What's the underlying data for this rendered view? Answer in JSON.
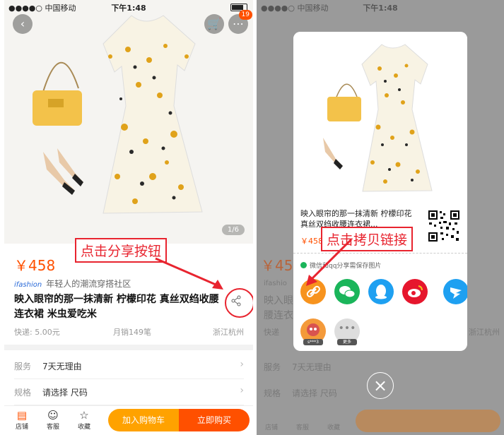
{
  "status": {
    "carrier": "●●●●○ 中国移动",
    "time": "下午1:48"
  },
  "left": {
    "cart_badge": "19",
    "pager": "1/6",
    "price": "￥458",
    "shop_logo": "ifashion",
    "shop_name": "年轻人的潮流穿搭社区",
    "title": "映入眼帘的那一抹清新 柠檬印花 真丝双绉收腰连衣裙 米虫爱吃米",
    "shipping": "快递: 5.00元",
    "sales": "月销149笔",
    "location": "浙江杭州",
    "service_key": "服务",
    "service_val": "7天无理由",
    "spec_key": "规格",
    "spec_val": "请选择 尺码",
    "tabs": [
      "店铺",
      "客服",
      "收藏"
    ],
    "add_cart": "加入购物车",
    "buy_now": "立即购买",
    "annotation": "点击分享按钮"
  },
  "right": {
    "modal_title": "映入眼帘的那一抹清新 柠檬印花 真丝双绉收腰连衣裙...",
    "modal_price": "￥458",
    "hint": "微信和qq分享需保存图片",
    "avatar_labels": [
      "s***3",
      "更多"
    ],
    "annotation": "点击拷贝链接",
    "bg_texts": [
      "￥45",
      "ifashio",
      "映入眼",
      "腰连衣",
      "快递",
      "浙江杭州",
      "服务",
      "7天无理由",
      "规格",
      "请选择 尺码",
      "店铺",
      "客服",
      "收藏"
    ]
  },
  "colors": {
    "accent": "#ff5000",
    "callout": "#e8242f",
    "wechat": "#1ab55a",
    "qq": "#1ea0f1",
    "weibo": "#e6162d",
    "link": "#f7931e"
  }
}
